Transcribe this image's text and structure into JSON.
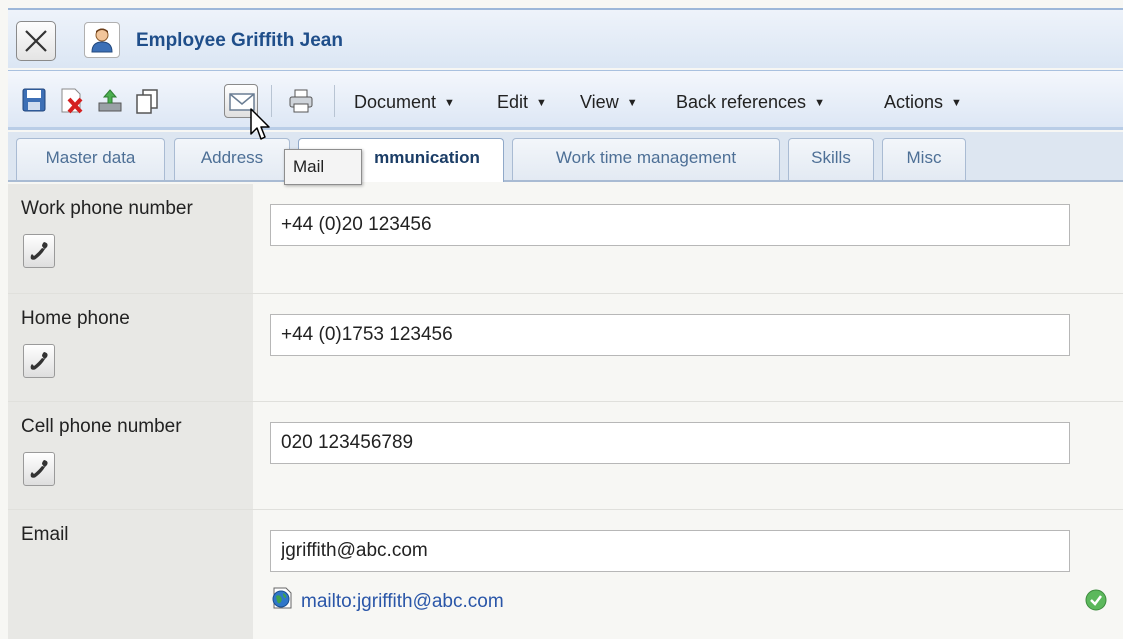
{
  "window": {
    "title": "Employee Griffith Jean"
  },
  "toolbar": {
    "icons": [
      "save-icon",
      "delete-icon",
      "upload-icon",
      "copy-icon",
      "mail-icon",
      "print-icon"
    ],
    "menus": [
      {
        "label": "Document"
      },
      {
        "label": "Edit"
      },
      {
        "label": "View"
      },
      {
        "label": "Back references"
      },
      {
        "label": "Actions"
      }
    ],
    "arrow": "▼"
  },
  "tabs": [
    {
      "label": "Master data"
    },
    {
      "label": "Address"
    },
    {
      "label": "mmunication",
      "active": true
    },
    {
      "label": "Work time management"
    },
    {
      "label": "Skills"
    },
    {
      "label": "Misc"
    }
  ],
  "tooltip": {
    "text": "Mail"
  },
  "fields": {
    "work_phone": {
      "label": "Work phone number",
      "value": "+44 (0)20 123456"
    },
    "home_phone": {
      "label": "Home phone",
      "value": "+44 (0)1753 123456"
    },
    "cell_phone": {
      "label": "Cell phone number",
      "value": "020 123456789"
    },
    "email": {
      "label": "Email",
      "value": "jgriffith@abc.com",
      "link": "mailto:jgriffith@abc.com"
    }
  },
  "colors": {
    "title": "#1f4e8a",
    "link": "#2a56a8",
    "valid": "#5cb85c"
  }
}
